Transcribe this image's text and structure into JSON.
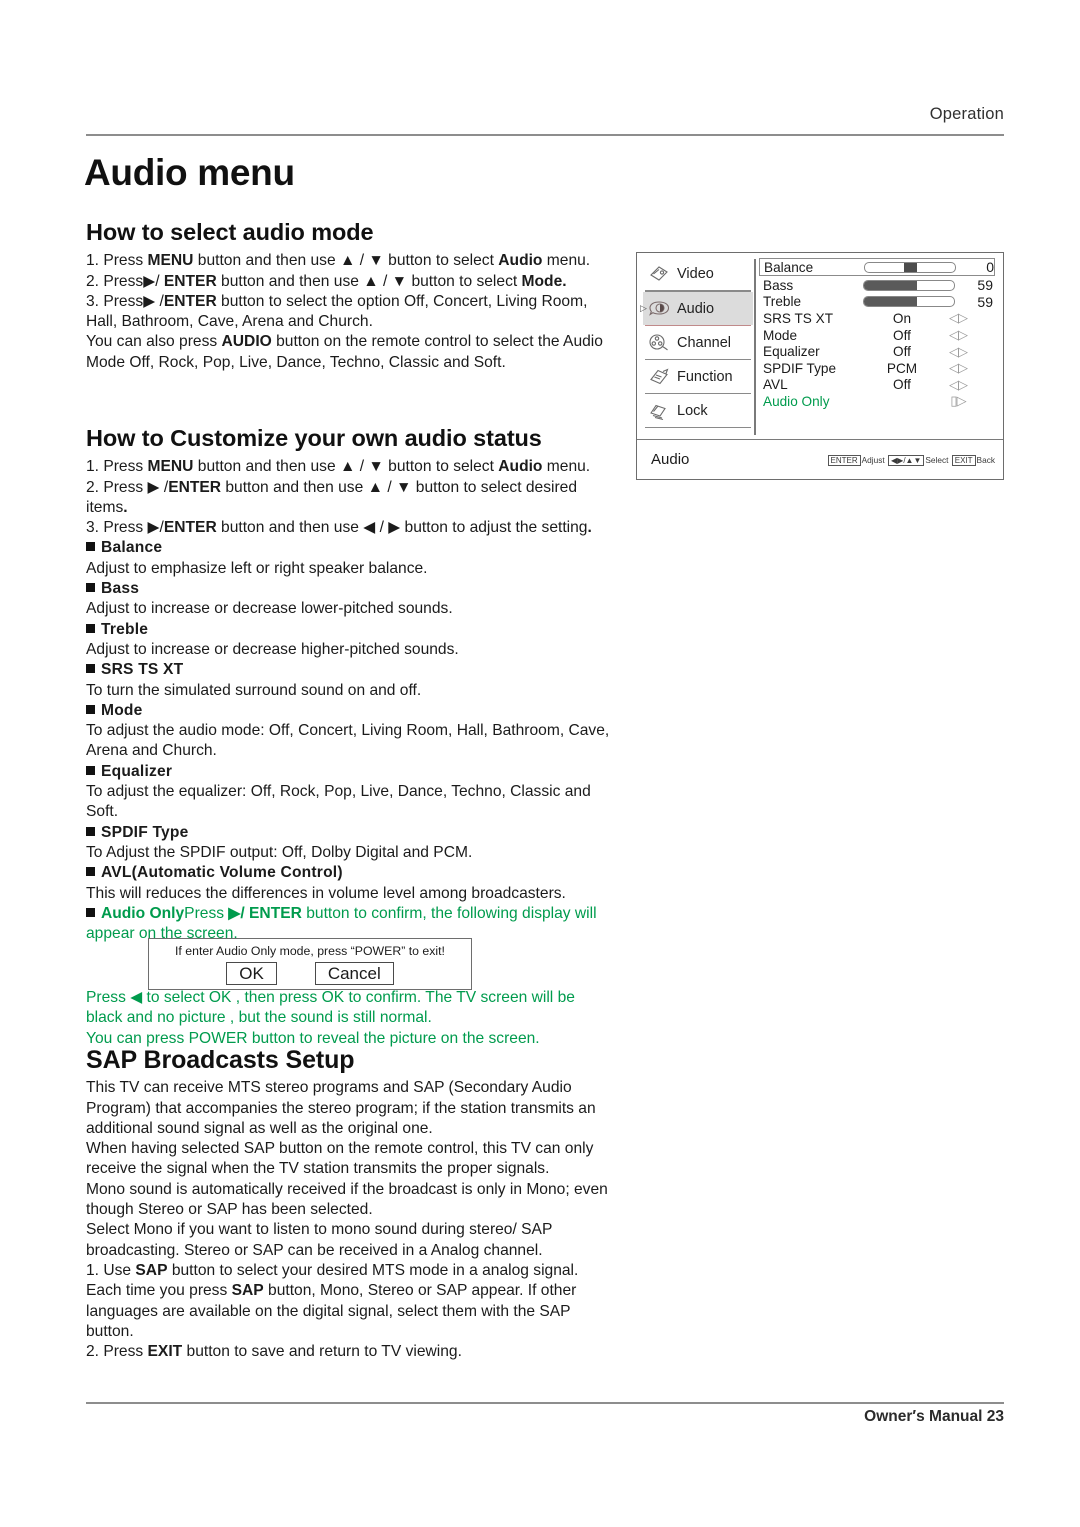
{
  "header": {
    "section_label": "Operation"
  },
  "page_title": "Audio menu",
  "sections": {
    "select_mode": {
      "heading": "How to select audio mode",
      "steps": [
        "1. Press MENU button and then use ▲ / ▼ button to select Audio menu.",
        "2. Press ▶/ ENTER button and then use ▲ / ▼ button to select Mode.",
        "3. Press ▶ /ENTER button to select the option Off, Concert, Living Room, Hall, Bathroom, Cave, Arena and Church.",
        "You can also press AUDIO button on the remote control to select the Audio Mode Off, Rock, Pop, Live, Dance, Techno, Classic and Soft."
      ]
    },
    "customize": {
      "heading": "How to Customize your own audio status",
      "steps": [
        "1. Press MENU button and then use ▲ / ▼ button to select Audio menu.",
        "2. Press ▶ /ENTER button and then use ▲ / ▼ button to select desired items.",
        "3. Press ▶/ENTER button and then use ◀ / ▶ button to adjust the setting."
      ],
      "items": [
        {
          "title": "Balance",
          "desc": "Adjust to emphasize left or right speaker balance."
        },
        {
          "title": "Bass",
          "desc": "Adjust to increase or decrease lower-pitched sounds."
        },
        {
          "title": "Treble",
          "desc": "Adjust to increase or decrease higher-pitched sounds."
        },
        {
          "title": "SRS TS XT",
          "desc": "To turn the simulated surround sound on and off."
        },
        {
          "title": "Mode",
          "desc": "To adjust  the audio mode: Off, Concert, Living Room, Hall, Bathroom, Cave, Arena and Church."
        },
        {
          "title": "Equalizer",
          "desc": "To adjust  the equalizer: Off, Rock, Pop, Live, Dance, Techno, Classic and Soft."
        },
        {
          "title": "SPDIF Type",
          "desc": "To Adjust the SPDIF output: Off, Dolby Digital and  PCM."
        },
        {
          "title": "AVL(Automatic Volume Control)",
          "desc": "This will reduces the differences in volume level among broadcasters."
        }
      ],
      "audio_only": {
        "title": "Audio Only",
        "line_a": "Press ",
        "line_b": "▶/ ENTER",
        "line_c": " button to confirm, the following display will appear on the screen."
      },
      "after_dialog": [
        "Press ◀ to select OK , then press OK to confirm. The TV screen will be black and no picture , but the sound is still normal.",
        "You can press POWER button to reveal the picture on the screen."
      ]
    },
    "sap": {
      "heading": "SAP Broadcasts Setup",
      "paragraphs": [
        "This TV can receive MTS stereo programs and SAP (Secondary Audio Program) that accompanies the stereo program; if the station transmits an additional sound signal as well as the original one.",
        "When having selected SAP button on the remote control, this TV can only receive the signal when the TV station transmits the proper signals.",
        "Mono sound is automatically received if the broadcast is only in Mono; even though Stereo or SAP has been selected.",
        "Select Mono if you want to listen to mono sound during stereo/ SAP broadcasting. Stereo or SAP can be received in a Analog channel.",
        "1. Use SAP button to select your desired MTS mode in a analog signal.",
        "Each time you press SAP button, Mono, Stereo or SAP appear. If other languages are available on the digital signal, select them with the SAP button.",
        "2. Press EXIT button to save and return to TV viewing."
      ]
    }
  },
  "dialog": {
    "message": "If enter Audio Only mode, press “POWER” to exit!",
    "ok_label": "OK",
    "cancel_label": "Cancel"
  },
  "osd": {
    "sidebar": [
      {
        "label": "Video",
        "icon": "video-icon",
        "selected": false
      },
      {
        "label": "Audio",
        "icon": "audio-icon",
        "selected": true
      },
      {
        "label": "Channel",
        "icon": "channel-icon",
        "selected": false
      },
      {
        "label": "Function",
        "icon": "function-icon",
        "selected": false
      },
      {
        "label": "Lock",
        "icon": "lock-icon",
        "selected": false
      }
    ],
    "items": [
      {
        "name": "Balance",
        "kind": "slider",
        "percent": 50,
        "value": "0",
        "framed": true,
        "knob": true
      },
      {
        "name": "Bass",
        "kind": "slider",
        "percent": 59,
        "value": "59",
        "framed": false,
        "knob": false
      },
      {
        "name": "Treble",
        "kind": "slider",
        "percent": 59,
        "value": "59",
        "framed": false,
        "knob": false
      },
      {
        "name": "SRS TS XT",
        "kind": "option",
        "value": "On",
        "arrow": "◁▷"
      },
      {
        "name": "Mode",
        "kind": "option",
        "value": "Off",
        "arrow": "◁▷"
      },
      {
        "name": "Equalizer",
        "kind": "option",
        "value": "Off",
        "arrow": "◁▷"
      },
      {
        "name": "SPDIF Type",
        "kind": "option",
        "value": "PCM",
        "arrow": "◁▷"
      },
      {
        "name": "AVL",
        "kind": "option",
        "value": "Off",
        "arrow": "◁▷"
      },
      {
        "name": "Audio Only",
        "kind": "action",
        "value": "",
        "arrow": "▯▷",
        "green": true
      }
    ],
    "footer_label": "Audio",
    "hints": {
      "enter_key": "ENTER",
      "enter_action": "Adjust",
      "nav_key": "◀▶/▲▼",
      "nav_action": "Select",
      "exit_key": "EXIT",
      "exit_action": "Back"
    }
  },
  "footer": {
    "text": "Owner′s Manual  23"
  },
  "colors": {
    "green": "#009b4d",
    "highlight": "#dcdcdc",
    "rule": "#8d8d8d"
  }
}
